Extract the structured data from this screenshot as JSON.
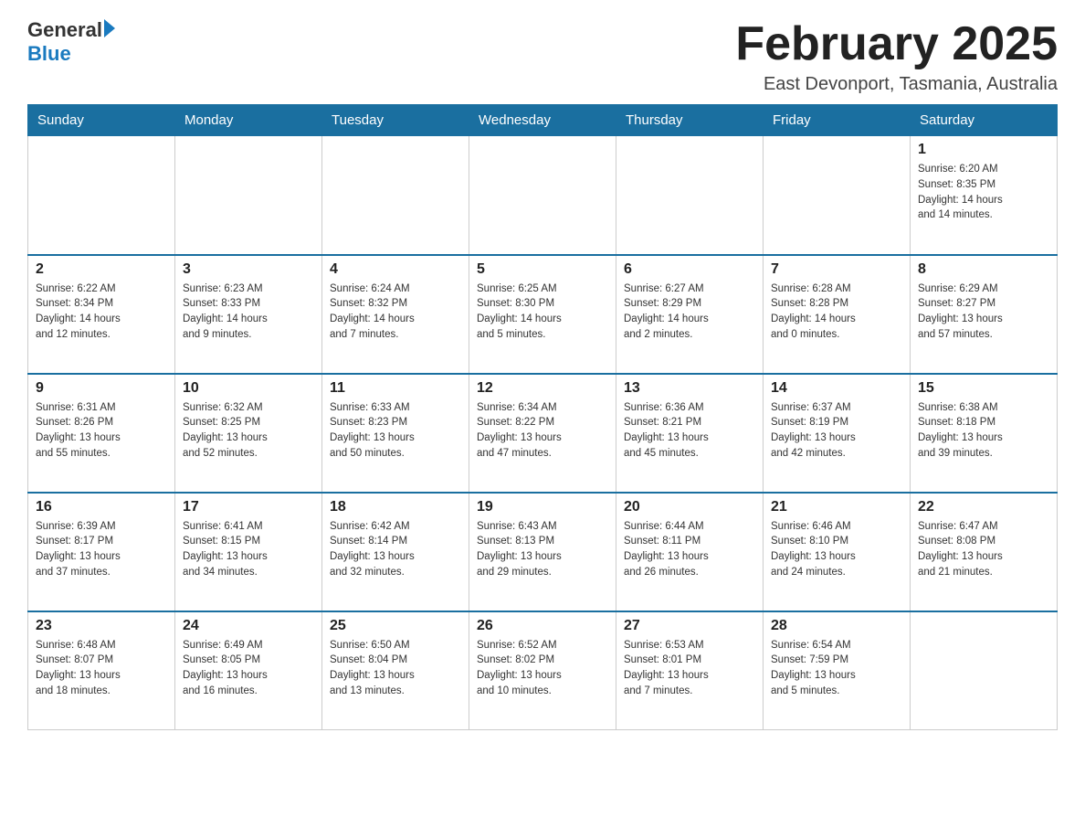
{
  "header": {
    "logo_general": "General",
    "logo_blue": "Blue",
    "title": "February 2025",
    "location": "East Devonport, Tasmania, Australia"
  },
  "days_of_week": [
    "Sunday",
    "Monday",
    "Tuesday",
    "Wednesday",
    "Thursday",
    "Friday",
    "Saturday"
  ],
  "weeks": [
    [
      {
        "day": "",
        "info": ""
      },
      {
        "day": "",
        "info": ""
      },
      {
        "day": "",
        "info": ""
      },
      {
        "day": "",
        "info": ""
      },
      {
        "day": "",
        "info": ""
      },
      {
        "day": "",
        "info": ""
      },
      {
        "day": "1",
        "info": "Sunrise: 6:20 AM\nSunset: 8:35 PM\nDaylight: 14 hours\nand 14 minutes."
      }
    ],
    [
      {
        "day": "2",
        "info": "Sunrise: 6:22 AM\nSunset: 8:34 PM\nDaylight: 14 hours\nand 12 minutes."
      },
      {
        "day": "3",
        "info": "Sunrise: 6:23 AM\nSunset: 8:33 PM\nDaylight: 14 hours\nand 9 minutes."
      },
      {
        "day": "4",
        "info": "Sunrise: 6:24 AM\nSunset: 8:32 PM\nDaylight: 14 hours\nand 7 minutes."
      },
      {
        "day": "5",
        "info": "Sunrise: 6:25 AM\nSunset: 8:30 PM\nDaylight: 14 hours\nand 5 minutes."
      },
      {
        "day": "6",
        "info": "Sunrise: 6:27 AM\nSunset: 8:29 PM\nDaylight: 14 hours\nand 2 minutes."
      },
      {
        "day": "7",
        "info": "Sunrise: 6:28 AM\nSunset: 8:28 PM\nDaylight: 14 hours\nand 0 minutes."
      },
      {
        "day": "8",
        "info": "Sunrise: 6:29 AM\nSunset: 8:27 PM\nDaylight: 13 hours\nand 57 minutes."
      }
    ],
    [
      {
        "day": "9",
        "info": "Sunrise: 6:31 AM\nSunset: 8:26 PM\nDaylight: 13 hours\nand 55 minutes."
      },
      {
        "day": "10",
        "info": "Sunrise: 6:32 AM\nSunset: 8:25 PM\nDaylight: 13 hours\nand 52 minutes."
      },
      {
        "day": "11",
        "info": "Sunrise: 6:33 AM\nSunset: 8:23 PM\nDaylight: 13 hours\nand 50 minutes."
      },
      {
        "day": "12",
        "info": "Sunrise: 6:34 AM\nSunset: 8:22 PM\nDaylight: 13 hours\nand 47 minutes."
      },
      {
        "day": "13",
        "info": "Sunrise: 6:36 AM\nSunset: 8:21 PM\nDaylight: 13 hours\nand 45 minutes."
      },
      {
        "day": "14",
        "info": "Sunrise: 6:37 AM\nSunset: 8:19 PM\nDaylight: 13 hours\nand 42 minutes."
      },
      {
        "day": "15",
        "info": "Sunrise: 6:38 AM\nSunset: 8:18 PM\nDaylight: 13 hours\nand 39 minutes."
      }
    ],
    [
      {
        "day": "16",
        "info": "Sunrise: 6:39 AM\nSunset: 8:17 PM\nDaylight: 13 hours\nand 37 minutes."
      },
      {
        "day": "17",
        "info": "Sunrise: 6:41 AM\nSunset: 8:15 PM\nDaylight: 13 hours\nand 34 minutes."
      },
      {
        "day": "18",
        "info": "Sunrise: 6:42 AM\nSunset: 8:14 PM\nDaylight: 13 hours\nand 32 minutes."
      },
      {
        "day": "19",
        "info": "Sunrise: 6:43 AM\nSunset: 8:13 PM\nDaylight: 13 hours\nand 29 minutes."
      },
      {
        "day": "20",
        "info": "Sunrise: 6:44 AM\nSunset: 8:11 PM\nDaylight: 13 hours\nand 26 minutes."
      },
      {
        "day": "21",
        "info": "Sunrise: 6:46 AM\nSunset: 8:10 PM\nDaylight: 13 hours\nand 24 minutes."
      },
      {
        "day": "22",
        "info": "Sunrise: 6:47 AM\nSunset: 8:08 PM\nDaylight: 13 hours\nand 21 minutes."
      }
    ],
    [
      {
        "day": "23",
        "info": "Sunrise: 6:48 AM\nSunset: 8:07 PM\nDaylight: 13 hours\nand 18 minutes."
      },
      {
        "day": "24",
        "info": "Sunrise: 6:49 AM\nSunset: 8:05 PM\nDaylight: 13 hours\nand 16 minutes."
      },
      {
        "day": "25",
        "info": "Sunrise: 6:50 AM\nSunset: 8:04 PM\nDaylight: 13 hours\nand 13 minutes."
      },
      {
        "day": "26",
        "info": "Sunrise: 6:52 AM\nSunset: 8:02 PM\nDaylight: 13 hours\nand 10 minutes."
      },
      {
        "day": "27",
        "info": "Sunrise: 6:53 AM\nSunset: 8:01 PM\nDaylight: 13 hours\nand 7 minutes."
      },
      {
        "day": "28",
        "info": "Sunrise: 6:54 AM\nSunset: 7:59 PM\nDaylight: 13 hours\nand 5 minutes."
      },
      {
        "day": "",
        "info": ""
      }
    ]
  ]
}
